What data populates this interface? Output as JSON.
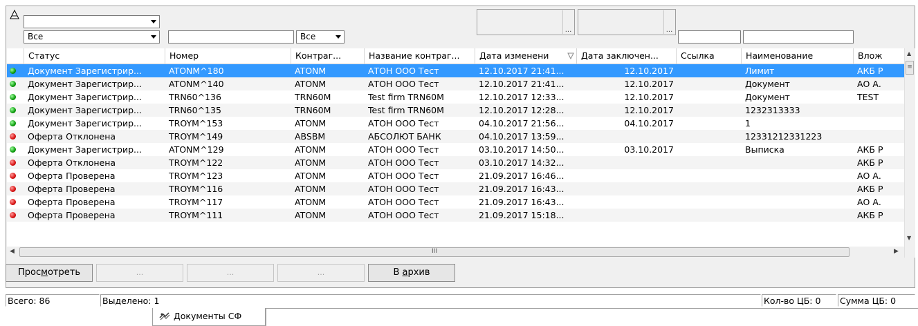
{
  "filters": {
    "top_combo_value": "",
    "status_combo_value": "Все",
    "number_filter_value": "",
    "contractor_combo_value": "Все",
    "date_change_button": "...",
    "date_conclusion_button": "...",
    "link_filter_value": "",
    "name_filter_value": ""
  },
  "columns": [
    "Статус",
    "Номер",
    "Контраг...",
    "Название контраг...",
    "Дата изменени",
    "Дата заключен...",
    "Ссылка",
    "Наименование",
    "Влож"
  ],
  "rows": [
    {
      "status": "Документ Зарегистрир...",
      "color": "green",
      "number": "ATONM^180",
      "contr": "ATONM",
      "contr_name": "АТОН ООО Тест",
      "date_changed": "12.10.2017 21:41...",
      "date_concl": "12.10.2017",
      "link": "",
      "name": "Лимит",
      "attach": "АКБ Р"
    },
    {
      "status": "Документ Зарегистрир...",
      "color": "green",
      "number": "ATONM^140",
      "contr": "ATONM",
      "contr_name": "АТОН ООО Тест",
      "date_changed": "12.10.2017 21:41...",
      "date_concl": "12.10.2017",
      "link": "",
      "name": "Документ",
      "attach": "АО А."
    },
    {
      "status": "Документ Зарегистрир...",
      "color": "green",
      "number": "TRN60^136",
      "contr": "TRN60M",
      "contr_name": "Test firm TRN60M",
      "date_changed": "12.10.2017 12:33...",
      "date_concl": "12.10.2017",
      "link": "",
      "name": "Документ",
      "attach": "TEST"
    },
    {
      "status": "Документ Зарегистрир...",
      "color": "green",
      "number": "TRN60^135",
      "contr": "TRN60M",
      "contr_name": "Test firm TRN60M",
      "date_changed": "12.10.2017 12:28...",
      "date_concl": "12.10.2017",
      "link": "",
      "name": "1232313333",
      "attach": ""
    },
    {
      "status": "Документ Зарегистрир...",
      "color": "green",
      "number": "TROYM^153",
      "contr": "ATONM",
      "contr_name": "АТОН ООО Тест",
      "date_changed": "04.10.2017 21:56...",
      "date_concl": "04.10.2017",
      "link": "",
      "name": "1",
      "attach": ""
    },
    {
      "status": "Оферта Отклонена",
      "color": "red",
      "number": "TROYM^149",
      "contr": "ABSBM",
      "contr_name": "АБСОЛЮТ БАНК",
      "date_changed": "04.10.2017 13:59...",
      "date_concl": "",
      "link": "",
      "name": "12331212331223",
      "attach": ""
    },
    {
      "status": "Документ Зарегистрир...",
      "color": "green",
      "number": "ATONM^129",
      "contr": "ATONM",
      "contr_name": "АТОН ООО Тест",
      "date_changed": "03.10.2017 14:50...",
      "date_concl": "03.10.2017",
      "link": "",
      "name": "Выписка",
      "attach": "АКБ Р"
    },
    {
      "status": "Оферта Отклонена",
      "color": "red",
      "number": "TROYM^122",
      "contr": "ATONM",
      "contr_name": "АТОН ООО Тест",
      "date_changed": "03.10.2017 14:32...",
      "date_concl": "",
      "link": "",
      "name": "",
      "attach": "АКБ Р"
    },
    {
      "status": "Оферта Проверена",
      "color": "red",
      "number": "TROYM^123",
      "contr": "ATONM",
      "contr_name": "АТОН ООО Тест",
      "date_changed": "21.09.2017 16:46...",
      "date_concl": "",
      "link": "",
      "name": "",
      "attach": "АО А."
    },
    {
      "status": "Оферта Проверена",
      "color": "red",
      "number": "TROYM^116",
      "contr": "ATONM",
      "contr_name": "АТОН ООО Тест",
      "date_changed": "21.09.2017 16:43...",
      "date_concl": "",
      "link": "",
      "name": "",
      "attach": "АКБ Р"
    },
    {
      "status": "Оферта Проверена",
      "color": "red",
      "number": "TROYM^117",
      "contr": "ATONM",
      "contr_name": "АТОН ООО Тест",
      "date_changed": "21.09.2017 16:43...",
      "date_concl": "",
      "link": "",
      "name": "",
      "attach": "АО А."
    },
    {
      "status": "Оферта Проверена",
      "color": "red",
      "number": "TROYM^111",
      "contr": "ATONM",
      "contr_name": "АТОН ООО Тест",
      "date_changed": "21.09.2017 15:18...",
      "date_concl": "",
      "link": "",
      "name": "",
      "attach": "АКБ Р"
    }
  ],
  "scroll": {
    "h_thumb_label": "III"
  },
  "buttons": {
    "view_prefix": "Прос",
    "view_mnemonic": "м",
    "view_suffix": "отреть",
    "blank1": "...",
    "blank2": "...",
    "blank3": "...",
    "archive_prefix": "В ",
    "archive_mnemonic": "а",
    "archive_suffix": "рхив"
  },
  "status": {
    "total": "Всего: 86",
    "selected": "Выделено: 1",
    "count_cb": "Кол-во ЦБ: 0",
    "sum_cb": "Сумма ЦБ: 0"
  },
  "tab": {
    "label": "Документы СФ"
  },
  "colors": {
    "selection": "#3399ff",
    "green_status": "#0b9b0b",
    "red_status": "#d81010"
  }
}
